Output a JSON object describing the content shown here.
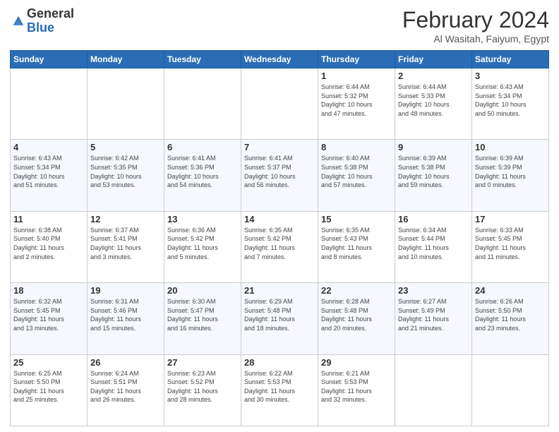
{
  "header": {
    "logo": {
      "line1": "General",
      "line2": "Blue"
    },
    "title": "February 2024",
    "location": "Al Wasitah, Faiyum, Egypt"
  },
  "weekdays": [
    "Sunday",
    "Monday",
    "Tuesday",
    "Wednesday",
    "Thursday",
    "Friday",
    "Saturday"
  ],
  "weeks": [
    [
      {
        "day": "",
        "info": ""
      },
      {
        "day": "",
        "info": ""
      },
      {
        "day": "",
        "info": ""
      },
      {
        "day": "",
        "info": ""
      },
      {
        "day": "1",
        "info": "Sunrise: 6:44 AM\nSunset: 5:32 PM\nDaylight: 10 hours\nand 47 minutes."
      },
      {
        "day": "2",
        "info": "Sunrise: 6:44 AM\nSunset: 5:33 PM\nDaylight: 10 hours\nand 48 minutes."
      },
      {
        "day": "3",
        "info": "Sunrise: 6:43 AM\nSunset: 5:34 PM\nDaylight: 10 hours\nand 50 minutes."
      }
    ],
    [
      {
        "day": "4",
        "info": "Sunrise: 6:43 AM\nSunset: 5:34 PM\nDaylight: 10 hours\nand 51 minutes."
      },
      {
        "day": "5",
        "info": "Sunrise: 6:42 AM\nSunset: 5:35 PM\nDaylight: 10 hours\nand 53 minutes."
      },
      {
        "day": "6",
        "info": "Sunrise: 6:41 AM\nSunset: 5:36 PM\nDaylight: 10 hours\nand 54 minutes."
      },
      {
        "day": "7",
        "info": "Sunrise: 6:41 AM\nSunset: 5:37 PM\nDaylight: 10 hours\nand 56 minutes."
      },
      {
        "day": "8",
        "info": "Sunrise: 6:40 AM\nSunset: 5:38 PM\nDaylight: 10 hours\nand 57 minutes."
      },
      {
        "day": "9",
        "info": "Sunrise: 6:39 AM\nSunset: 5:38 PM\nDaylight: 10 hours\nand 59 minutes."
      },
      {
        "day": "10",
        "info": "Sunrise: 6:39 AM\nSunset: 5:39 PM\nDaylight: 11 hours\nand 0 minutes."
      }
    ],
    [
      {
        "day": "11",
        "info": "Sunrise: 6:38 AM\nSunset: 5:40 PM\nDaylight: 11 hours\nand 2 minutes."
      },
      {
        "day": "12",
        "info": "Sunrise: 6:37 AM\nSunset: 5:41 PM\nDaylight: 11 hours\nand 3 minutes."
      },
      {
        "day": "13",
        "info": "Sunrise: 6:36 AM\nSunset: 5:42 PM\nDaylight: 11 hours\nand 5 minutes."
      },
      {
        "day": "14",
        "info": "Sunrise: 6:35 AM\nSunset: 5:42 PM\nDaylight: 11 hours\nand 7 minutes."
      },
      {
        "day": "15",
        "info": "Sunrise: 6:35 AM\nSunset: 5:43 PM\nDaylight: 11 hours\nand 8 minutes."
      },
      {
        "day": "16",
        "info": "Sunrise: 6:34 AM\nSunset: 5:44 PM\nDaylight: 11 hours\nand 10 minutes."
      },
      {
        "day": "17",
        "info": "Sunrise: 6:33 AM\nSunset: 5:45 PM\nDaylight: 11 hours\nand 11 minutes."
      }
    ],
    [
      {
        "day": "18",
        "info": "Sunrise: 6:32 AM\nSunset: 5:45 PM\nDaylight: 11 hours\nand 13 minutes."
      },
      {
        "day": "19",
        "info": "Sunrise: 6:31 AM\nSunset: 5:46 PM\nDaylight: 11 hours\nand 15 minutes."
      },
      {
        "day": "20",
        "info": "Sunrise: 6:30 AM\nSunset: 5:47 PM\nDaylight: 11 hours\nand 16 minutes."
      },
      {
        "day": "21",
        "info": "Sunrise: 6:29 AM\nSunset: 5:48 PM\nDaylight: 11 hours\nand 18 minutes."
      },
      {
        "day": "22",
        "info": "Sunrise: 6:28 AM\nSunset: 5:48 PM\nDaylight: 11 hours\nand 20 minutes."
      },
      {
        "day": "23",
        "info": "Sunrise: 6:27 AM\nSunset: 5:49 PM\nDaylight: 11 hours\nand 21 minutes."
      },
      {
        "day": "24",
        "info": "Sunrise: 6:26 AM\nSunset: 5:50 PM\nDaylight: 11 hours\nand 23 minutes."
      }
    ],
    [
      {
        "day": "25",
        "info": "Sunrise: 6:25 AM\nSunset: 5:50 PM\nDaylight: 11 hours\nand 25 minutes."
      },
      {
        "day": "26",
        "info": "Sunrise: 6:24 AM\nSunset: 5:51 PM\nDaylight: 11 hours\nand 26 minutes."
      },
      {
        "day": "27",
        "info": "Sunrise: 6:23 AM\nSunset: 5:52 PM\nDaylight: 11 hours\nand 28 minutes."
      },
      {
        "day": "28",
        "info": "Sunrise: 6:22 AM\nSunset: 5:53 PM\nDaylight: 11 hours\nand 30 minutes."
      },
      {
        "day": "29",
        "info": "Sunrise: 6:21 AM\nSunset: 5:53 PM\nDaylight: 11 hours\nand 32 minutes."
      },
      {
        "day": "",
        "info": ""
      },
      {
        "day": "",
        "info": ""
      }
    ]
  ]
}
